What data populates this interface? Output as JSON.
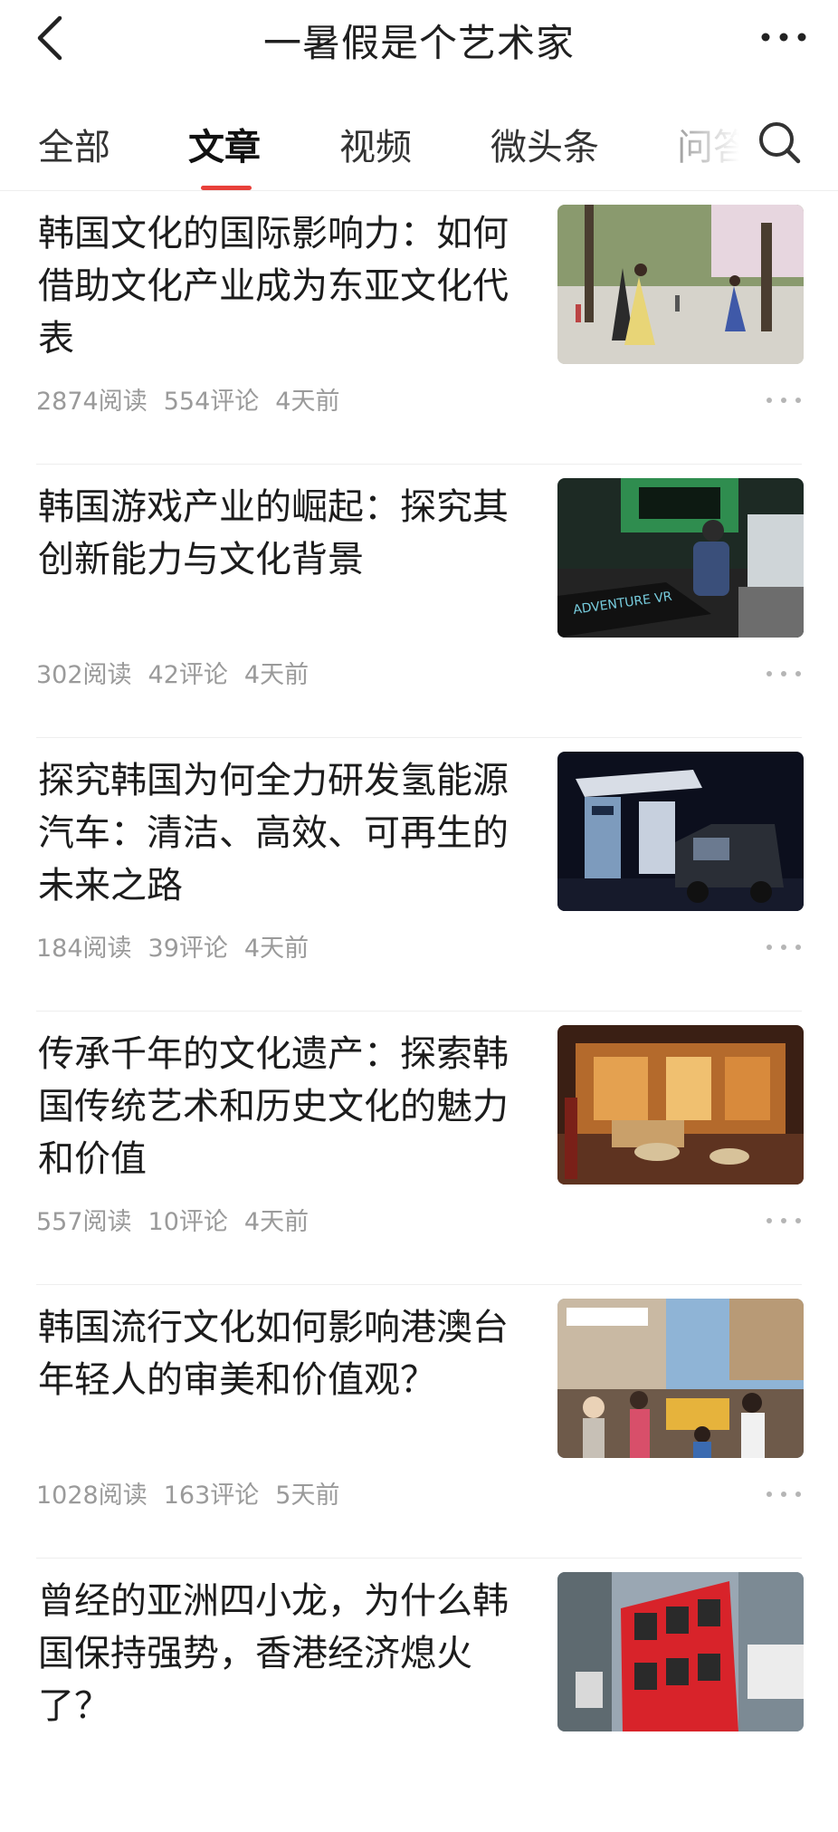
{
  "header": {
    "title": "一暑假是个艺术家",
    "back_icon": "chevron-left-icon",
    "more_icon": "more-horizontal-icon"
  },
  "tabs": [
    {
      "label": "全部"
    },
    {
      "label": "文章",
      "active": true
    },
    {
      "label": "视频"
    },
    {
      "label": "微头条"
    },
    {
      "label": "问答"
    }
  ],
  "search_icon": "search-icon",
  "accent_color": "#e8403a",
  "articles": [
    {
      "title": "韩国文化的国际影响力：如何借助文化产业成为东亚文化代表",
      "reads": "2874阅读",
      "comments": "554评论",
      "time": "4天前",
      "thumb": "hanbok street scene"
    },
    {
      "title": "韩国游戏产业的崛起：探究其创新能力与文化背景",
      "reads": "302阅读",
      "comments": "42评论",
      "time": "4天前",
      "thumb": "VR arcade game"
    },
    {
      "title": "探究韩国为何全力研发氢能源汽车：清洁、高效、可再生的未来之路",
      "reads": "184阅读",
      "comments": "39评论",
      "time": "4天前",
      "thumb": "hydrogen truck station"
    },
    {
      "title": "传承千年的文化遗产：探索韩国传统艺术和历史文化的魅力和价值",
      "reads": "557阅读",
      "comments": "10评论",
      "time": "4天前",
      "thumb": "traditional museum interior"
    },
    {
      "title": "韩国流行文化如何影响港澳台年轻人的审美和价值观？",
      "reads": "1028阅读",
      "comments": "163评论",
      "time": "5天前",
      "thumb": "crowded market street"
    },
    {
      "title": "曾经的亚洲四小龙，为什么韩国保持强势，香港经济熄火了？",
      "reads": "",
      "comments": "",
      "time": "",
      "thumb": "red double-decker tram"
    }
  ]
}
